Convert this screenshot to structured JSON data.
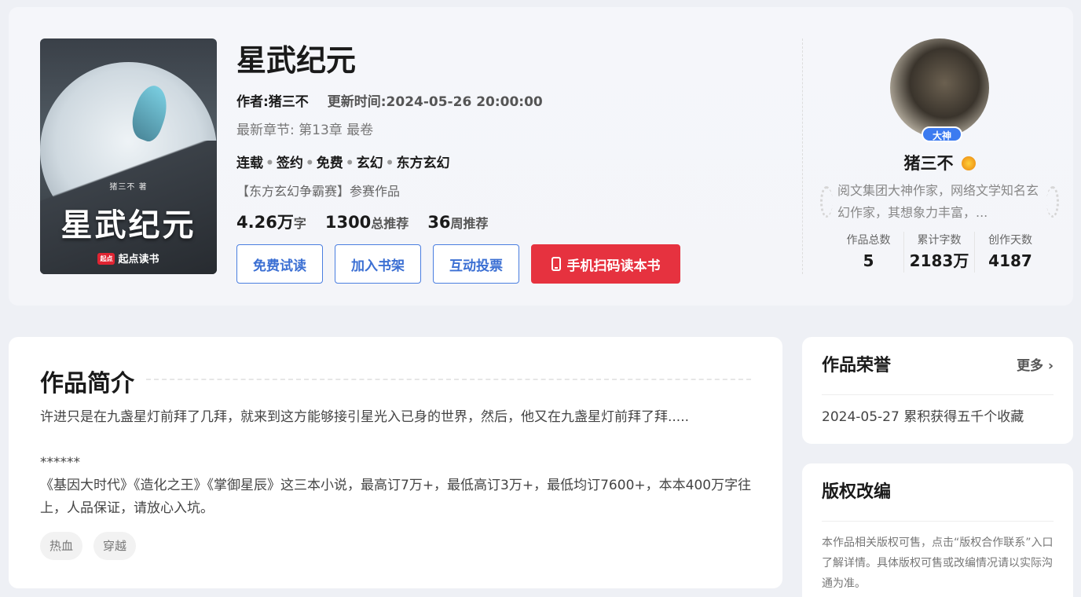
{
  "book": {
    "title": "星武纪元",
    "author_label": "作者:猪三不",
    "updated_label": "更新时间:2024-05-26 20:00:00",
    "latest_chapter": "最新章节: 第13章 最卷",
    "tags": [
      "连载",
      "签约",
      "免费",
      "玄幻",
      "东方玄幻"
    ],
    "tag_separator": "•",
    "contest": "【东方玄幻争霸赛】参赛作品",
    "stats": {
      "words_value": "4.26万",
      "words_unit": "字",
      "total_rec_value": "1300",
      "total_rec_unit": "总推荐",
      "week_rec_value": "36",
      "week_rec_unit": "周推荐"
    },
    "cover": {
      "author_text": "猪三不 著",
      "title_text": "星武纪元",
      "brand_logo": "起点",
      "brand_text": "起点读书"
    }
  },
  "actions": {
    "free_read": "免费试读",
    "add_shelf": "加入书架",
    "vote": "互动投票",
    "mobile_read": "手机扫码读本书"
  },
  "author": {
    "badge": "大神",
    "name": "猪三不",
    "description": "阅文集团大神作家，网络文学知名玄幻作家，其想象力丰富，...",
    "stats": [
      {
        "label": "作品总数",
        "value": "5"
      },
      {
        "label": "累计字数",
        "value": "2183万"
      },
      {
        "label": "创作天数",
        "value": "4187"
      }
    ]
  },
  "intro": {
    "title": "作品简介",
    "paragraphs": [
      "许进只是在九盏星灯前拜了几拜，就来到这方能够接引星光入已身的世界，然后，他又在九盏星灯前拜了拜.....",
      "",
      "******",
      "《基因大时代》《造化之王》《掌御星辰》这三本小说，最高订7万+，最低高订3万+，最低均订7600+，本本400万字往上，人品保证，请放心入坑。"
    ],
    "tags": [
      "热血",
      "穿越"
    ]
  },
  "honor": {
    "title": "作品荣誉",
    "more": "更多",
    "item": "2024-05-27 累积获得五千个收藏"
  },
  "copyright": {
    "title": "版权改编",
    "text": "本作品相关版权可售，点击“版权合作联系”入口了解详情。具体版权可售或改编情况请以实际沟通为准。"
  },
  "colors": {
    "accent_blue": "#3b6fd3",
    "accent_red": "#e6323f",
    "badge_blue": "#3c7bf0"
  }
}
